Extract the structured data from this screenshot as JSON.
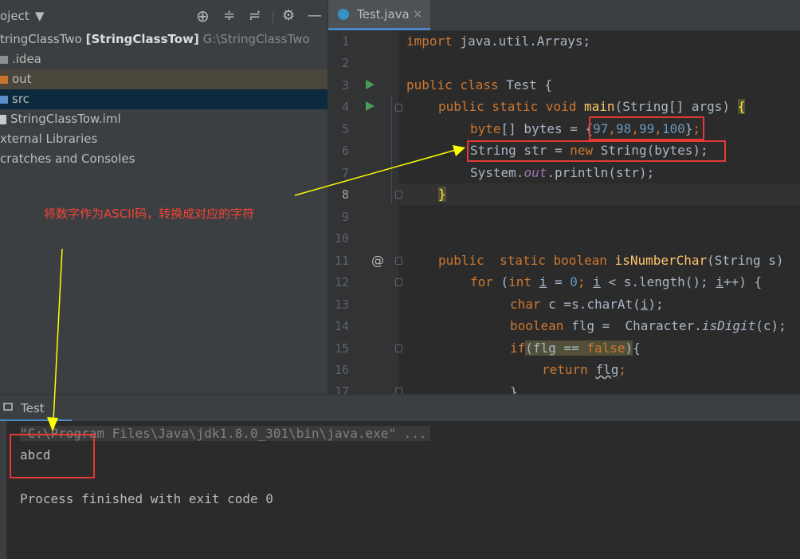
{
  "project_panel": {
    "title": "oject",
    "root_name": "tringClassTwo",
    "root_module": "[StringClassTow]",
    "root_path": "G:\\StringClassTwo",
    "items": [
      {
        "label": ".idea"
      },
      {
        "label": "out"
      },
      {
        "label": "src"
      },
      {
        "label": "StringClassTow.iml"
      },
      {
        "label": "xternal Libraries"
      },
      {
        "label": "cratches and Consoles"
      }
    ]
  },
  "editor": {
    "tab_label": "Test.java",
    "line_numbers": [
      "1",
      "2",
      "3",
      "4",
      "5",
      "6",
      "7",
      "8",
      "9",
      "10",
      "11",
      "12",
      "13",
      "14",
      "15",
      "16",
      "17"
    ],
    "code": {
      "l1_import": "import",
      "l1_rest": " java.util.Arrays;",
      "l3_public": "public",
      "l3_class": " class",
      "l3_rest": " Test {",
      "l4_mods": "public static void",
      "l4_main": " main",
      "l4_rest": "(String[] args) ",
      "l4_brace": "{",
      "l5_a": "byte",
      "l5_b": "[] bytes = ",
      "l5_open": "{",
      "l5_n1": "97",
      "l5_c1": ",",
      "l5_n2": "98",
      "l5_c2": ",",
      "l5_n3": "99",
      "l5_c3": ",",
      "l5_n4": "100",
      "l5_close": "}",
      "l5_semi": ";",
      "l6_a": "String str = ",
      "l6_new": "new",
      "l6_rest": " String(bytes);",
      "l7_a": "System.",
      "l7_out": "out",
      "l7_rest": ".println(str);",
      "l8_brace": "}",
      "l11_mods": "public  static boolean",
      "l11_fn": " isNumberChar",
      "l11_rest": "(String s)",
      "l12_for": "for",
      "l12_a": " (",
      "l12_int": "int",
      "l12_sp": " ",
      "l12_i1": "i",
      "l12_eq": " = ",
      "l12_zero": "0",
      "l12_semi": "; ",
      "l12_i2": "i",
      "l12_lt": " < s.length(); ",
      "l12_i3": "i",
      "l12_end": "++) {",
      "l13_char": "char",
      "l13_a": " c =s.charAt(",
      "l13_i": "i",
      "l13_b": ");",
      "l14_bool": "boolean",
      "l14_a": " flg =  Character.",
      "l14_isdigit": "isDigit",
      "l14_b": "(c);",
      "l15_if": "if",
      "l15_open": "(",
      "l15_flg": "flg == ",
      "l15_false": "false",
      "l15_close": ")",
      "l15_brace": "{",
      "l16_return": "return",
      "l16_sp": " ",
      "l16_flg": "flg",
      "l16_semi": ";",
      "l17_brace": "}"
    }
  },
  "annotation": {
    "text": "将数字作为ASCII码，转换成对应的字符"
  },
  "run_panel": {
    "tab_label": "Test",
    "command": "\"C:\\Program Files\\Java\\jdk1.8.0_301\\bin\\java.exe\" ...",
    "output": "abcd",
    "exit_message": "Process finished with exit code 0"
  },
  "colors": {
    "keyword": "#cc7832",
    "number": "#6897bb",
    "function": "#ffc66d",
    "field": "#9876aa",
    "annotation_red": "#e53935",
    "arrow_yellow": "#ffff00"
  }
}
